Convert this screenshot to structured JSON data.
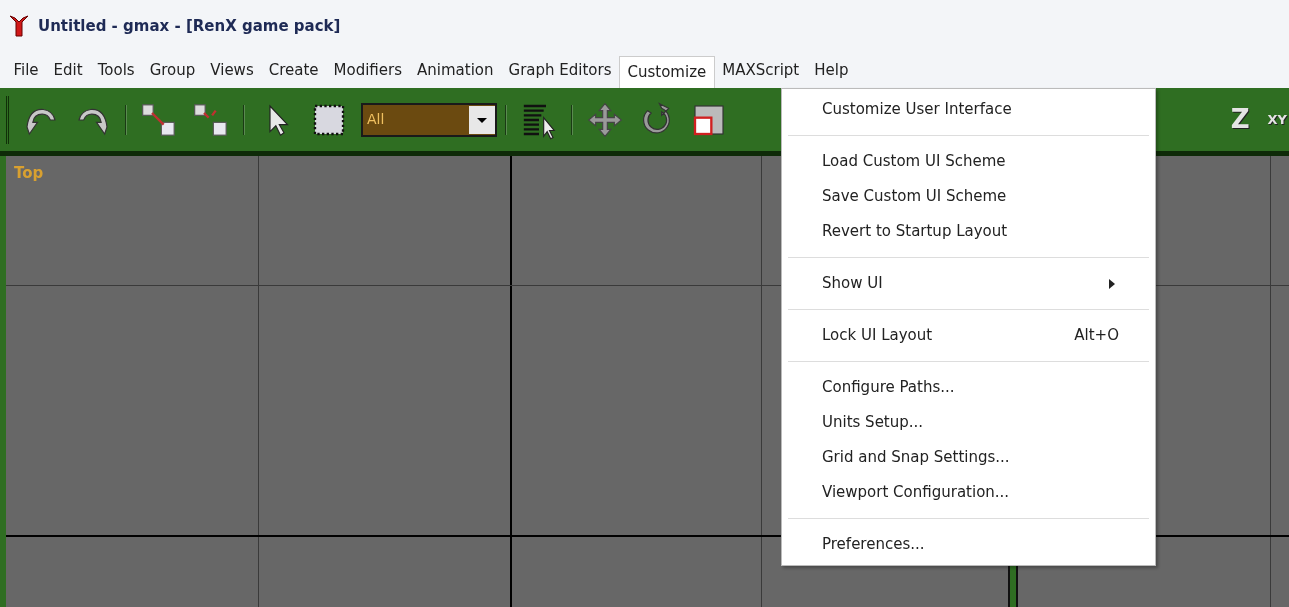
{
  "window": {
    "title": "Untitled - gmax - [RenX game pack]"
  },
  "menubar": [
    {
      "label": "File",
      "selected": false
    },
    {
      "label": "Edit",
      "selected": false
    },
    {
      "label": "Tools",
      "selected": false
    },
    {
      "label": "Group",
      "selected": false
    },
    {
      "label": "Views",
      "selected": false
    },
    {
      "label": "Create",
      "selected": false
    },
    {
      "label": "Modifiers",
      "selected": false
    },
    {
      "label": "Animation",
      "selected": false
    },
    {
      "label": "Graph Editors",
      "selected": false
    },
    {
      "label": "Customize",
      "selected": true
    },
    {
      "label": "MAXScript",
      "selected": false
    },
    {
      "label": "Help",
      "selected": false
    }
  ],
  "toolbar": {
    "selection_filter": {
      "value": "All"
    },
    "right_buttons": [
      "Z",
      "XY"
    ]
  },
  "viewport": {
    "label": "Top"
  },
  "menu": [
    {
      "kind": "item",
      "label": "Customize User Interface"
    },
    {
      "kind": "separator"
    },
    {
      "kind": "item",
      "label": "Load Custom UI Scheme"
    },
    {
      "kind": "item",
      "label": "Save Custom UI Scheme"
    },
    {
      "kind": "item",
      "label": "Revert to Startup Layout"
    },
    {
      "kind": "separator"
    },
    {
      "kind": "submenu",
      "label": "Show UI"
    },
    {
      "kind": "separator"
    },
    {
      "kind": "item",
      "label": "Lock UI Layout",
      "shortcut": "Alt+O"
    },
    {
      "kind": "separator"
    },
    {
      "kind": "item",
      "label": "Configure Paths..."
    },
    {
      "kind": "item",
      "label": "Units Setup..."
    },
    {
      "kind": "item",
      "label": "Grid and Snap Settings..."
    },
    {
      "kind": "item",
      "label": "Viewport Configuration..."
    },
    {
      "kind": "separator"
    },
    {
      "kind": "item",
      "label": "Preferences..."
    }
  ]
}
